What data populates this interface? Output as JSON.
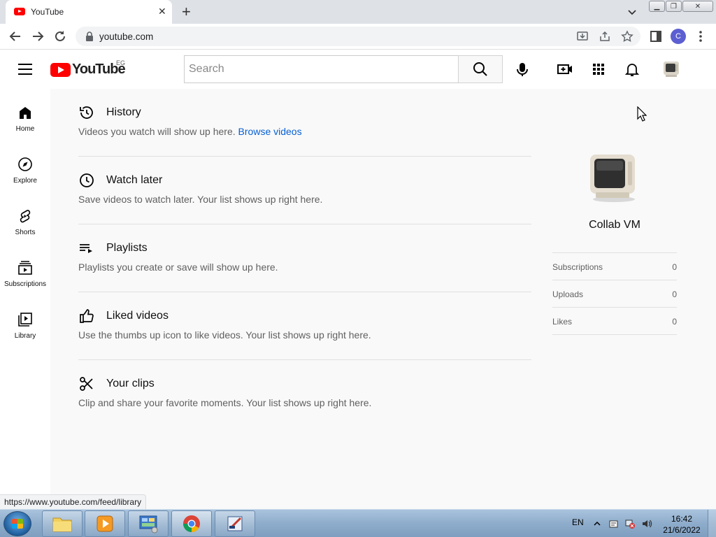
{
  "browser": {
    "tab_title": "YouTube",
    "url": "youtube.com",
    "profile_initial": "C",
    "status_url": "https://www.youtube.com/feed/library"
  },
  "header": {
    "logo_text": "YouTube",
    "country_code": "EG",
    "search_placeholder": "Search"
  },
  "guide": {
    "items": [
      {
        "label": "Home",
        "icon": "home-icon"
      },
      {
        "label": "Explore",
        "icon": "compass-icon"
      },
      {
        "label": "Shorts",
        "icon": "shorts-icon"
      },
      {
        "label": "Subscriptions",
        "icon": "subscriptions-icon"
      },
      {
        "label": "Library",
        "icon": "library-icon"
      }
    ]
  },
  "sections": [
    {
      "title": "History",
      "desc": "Videos you watch will show up here.",
      "link": "Browse videos",
      "icon": "history-icon"
    },
    {
      "title": "Watch later",
      "desc": "Save videos to watch later. Your list shows up right here.",
      "icon": "clock-icon"
    },
    {
      "title": "Playlists",
      "desc": "Playlists you create or save will show up here.",
      "icon": "playlist-icon"
    },
    {
      "title": "Liked videos",
      "desc": "Use the thumbs up icon to like videos. Your list shows up right here.",
      "icon": "thumbs-up-icon"
    },
    {
      "title": "Your clips",
      "desc": "Clip and share your favorite moments. Your list shows up right here.",
      "icon": "scissors-icon"
    }
  ],
  "channel": {
    "name": "Collab VM",
    "stats": [
      {
        "label": "Subscriptions",
        "value": "0"
      },
      {
        "label": "Uploads",
        "value": "0"
      },
      {
        "label": "Likes",
        "value": "0"
      }
    ]
  },
  "taskbar": {
    "language": "EN",
    "time": "16:42",
    "date": "21/6/2022"
  },
  "colors": {
    "brand_red": "#ff0000",
    "link_blue": "#065fd4",
    "background": "#f9f9f9"
  }
}
